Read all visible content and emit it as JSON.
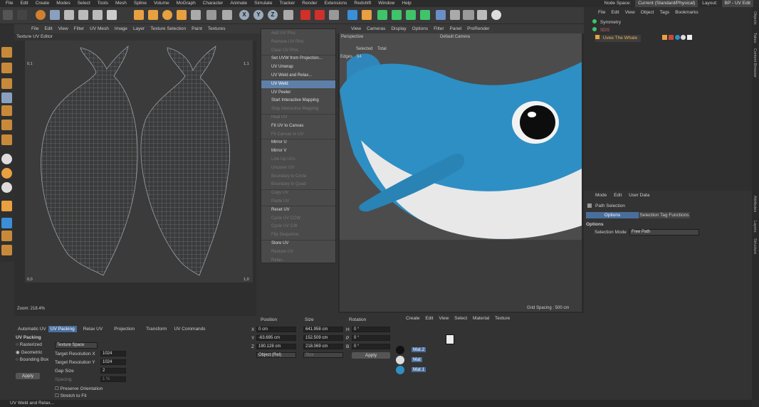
{
  "menubar": {
    "items": [
      "File",
      "Edit",
      "Create",
      "Modes",
      "Select",
      "Tools",
      "Mesh",
      "Spline",
      "Volume",
      "MoGraph",
      "Character",
      "Animate",
      "Simulate",
      "Tracker",
      "Render",
      "Extensions",
      "Redshift",
      "Window",
      "Help"
    ],
    "node_space_label": "Node Space:",
    "node_space_value": "Current (Standard/Physical)",
    "layout_label": "Layout:",
    "layout_value": "BP - UV Edit"
  },
  "toolbar": {
    "axis_x": "X",
    "axis_y": "Y",
    "axis_z": "Z"
  },
  "uv_editor": {
    "menu": [
      "File",
      "Edit",
      "View",
      "Filter",
      "UV Mesh",
      "Image",
      "Layer",
      "Texture Selection",
      "Paint",
      "Textures"
    ],
    "title": "Texture UV Editor",
    "tl_label": "0,1",
    "tr_label": "1,1",
    "bl_label": "0,0",
    "br_label": "1,0",
    "zoom": "Zoom: 218.4%"
  },
  "popup_menu": {
    "items": [
      {
        "label": "Add UV Pins",
        "dim": true
      },
      {
        "label": "Remove UV Pins",
        "dim": true
      },
      {
        "label": "Clear UV Pins",
        "dim": true
      },
      {
        "label": "Set UVW from Projection...",
        "dim": false
      },
      {
        "label": "UV Unwrap",
        "dim": false
      },
      {
        "label": "UV Weld and Relax...",
        "dim": false
      },
      {
        "label": "UV Weld",
        "dim": false
      },
      {
        "label": "UV Peeler",
        "dim": false
      },
      {
        "label": "Start Interactive Mapping",
        "dim": false
      },
      {
        "label": "Stop Interactive Mapping",
        "dim": true
      },
      {
        "label": "Heal UV",
        "dim": true
      },
      {
        "label": "Fit UV to Canvas",
        "dim": false
      },
      {
        "label": "Fit Canvas to UV",
        "dim": true
      },
      {
        "label": "Mirror U",
        "dim": false
      },
      {
        "label": "Mirror V",
        "dim": false
      },
      {
        "label": "Line Up UVs",
        "dim": true
      },
      {
        "label": "Uncover UV",
        "dim": true
      },
      {
        "label": "Boundary to Circle",
        "dim": true
      },
      {
        "label": "Boundary to Quad",
        "dim": true
      },
      {
        "label": "Copy UV",
        "dim": true
      },
      {
        "label": "Paste UV",
        "dim": true
      },
      {
        "label": "Reset UV",
        "dim": false
      },
      {
        "label": "Cycle UV CCW",
        "dim": true
      },
      {
        "label": "Cycle UV CW",
        "dim": true
      },
      {
        "label": "Flip Sequence",
        "dim": true
      },
      {
        "label": "Store UV",
        "dim": false
      },
      {
        "label": "Restore UV",
        "dim": true
      },
      {
        "label": "Relax...",
        "dim": true
      }
    ]
  },
  "viewport": {
    "menu": [
      "View",
      "Cameras",
      "Display",
      "Options",
      "Filter",
      "Panel",
      "ProRender"
    ],
    "perspective": "Perspective",
    "camera": "Default Camera",
    "selected": "Selected",
    "total": "Total",
    "edges_label": "Edges",
    "edges_value": "54",
    "grid_spacing": "Grid Spacing : 500 cm"
  },
  "objects": {
    "menu": [
      "File",
      "Edit",
      "View",
      "Object",
      "Tags",
      "Bookmarks"
    ],
    "rows": [
      "Symmetry",
      "SDS",
      "Uvee The Whale"
    ]
  },
  "attributes": {
    "menu": [
      "Mode",
      "Edit",
      "User Data"
    ],
    "title": "Path Selection",
    "tab_options": "Options",
    "tab_selection": "Selection Tag Functions",
    "section": "Options",
    "selection_mode_label": "Selection Mode",
    "selection_mode_value": "Free Path"
  },
  "side_tabs": [
    "Objects",
    "Takes",
    "Content Browser",
    "Attributes",
    "Layers",
    "Structure"
  ],
  "uv_tools": {
    "tabs": [
      "Automatic UV",
      "UV Packing",
      "Relax UV",
      "Projection",
      "Transform",
      "UV Commands"
    ],
    "section": "UV Packing",
    "radio_rasterized": "Rasterized",
    "radio_geometric": "Geometric",
    "radio_bounding": "Bounding Box",
    "texture_space": "Texture Space",
    "target_res_x_label": "Target Resolution X",
    "target_res_x": "1024",
    "target_res_y_label": "Target Resolution Y",
    "target_res_y": "1024",
    "gap_size_label": "Gap Size",
    "gap_size": "2",
    "spacing_label": "Spacing",
    "spacing": "1 %",
    "preserve_orientation": "Preserve Orientation",
    "stretch_to_fit": "Stretch to Fit",
    "apply": "Apply"
  },
  "coords": {
    "position": "Position",
    "size": "Size",
    "rotation": "Rotation",
    "x_label": "X",
    "x_pos": "0 cm",
    "x_size": "641.958 cm",
    "h_label": "H",
    "h_val": "0 °",
    "y_label": "Y",
    "y_pos": "-63.695 cm",
    "y_size": "152.509 cm",
    "p_label": "P",
    "p_val": "0 °",
    "z_label": "Z",
    "z_pos": "190.128 cm",
    "z_size": "218.069 cm",
    "b_label": "B",
    "b_val": "0 °",
    "mode": "Object (Rel)",
    "size_mode": "Size",
    "apply": "Apply"
  },
  "materials": {
    "menu": [
      "Create",
      "Edit",
      "View",
      "Select",
      "Material",
      "Texture"
    ],
    "items": [
      "Mat.2",
      "Mat",
      "Mat.1"
    ]
  },
  "status": "UV Weld and Relax..."
}
